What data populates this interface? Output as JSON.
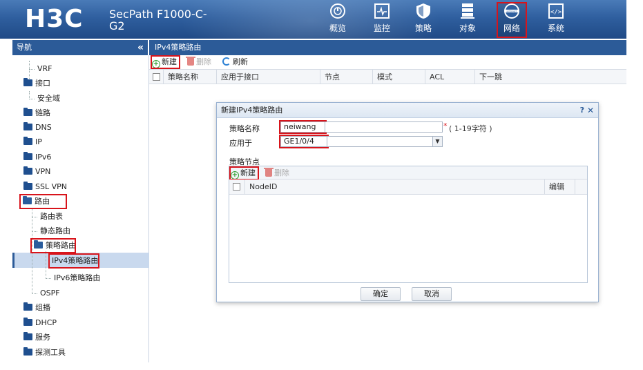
{
  "header": {
    "logo": "H3C",
    "product_line1": "SecPath F1000-C-",
    "product_line2": "G2",
    "nav": [
      {
        "label": "概览",
        "icon": "gauge-icon"
      },
      {
        "label": "监控",
        "icon": "monitor-icon"
      },
      {
        "label": "策略",
        "icon": "shield-icon"
      },
      {
        "label": "对象",
        "icon": "server-stack-icon"
      },
      {
        "label": "网络",
        "icon": "globe-internet-icon",
        "selected": true
      },
      {
        "label": "系统",
        "icon": "code-icon"
      }
    ]
  },
  "sidebar": {
    "title": "导航",
    "collapse": "«",
    "items": [
      {
        "label": "VRF"
      },
      {
        "label": "接口"
      },
      {
        "label": "安全域"
      },
      {
        "label": "链路"
      },
      {
        "label": "DNS"
      },
      {
        "label": "IP"
      },
      {
        "label": "IPv6"
      },
      {
        "label": "VPN"
      },
      {
        "label": "SSL VPN"
      },
      {
        "label": "路由"
      },
      {
        "label": "路由表"
      },
      {
        "label": "静态路由"
      },
      {
        "label": "策略路由"
      },
      {
        "label": "IPv4策略路由"
      },
      {
        "label": "IPv6策略路由"
      },
      {
        "label": "OSPF"
      },
      {
        "label": "组播"
      },
      {
        "label": "DHCP"
      },
      {
        "label": "服务"
      },
      {
        "label": "探测工具"
      }
    ]
  },
  "main": {
    "title": "IPv4策略路由",
    "toolbar": {
      "new": "新建",
      "delete": "删除",
      "refresh": "刷新"
    },
    "columns": [
      "策略名称",
      "应用于接口",
      "节点",
      "模式",
      "ACL",
      "下一跳"
    ]
  },
  "dialog": {
    "title": "新建IPv4策略路由",
    "help": "?",
    "close": "✕",
    "policy_name_label": "策略名称",
    "policy_name_value": "neiwang",
    "required": "*",
    "policy_name_hint": "( 1-19字符 )",
    "apply_label": "应用于",
    "apply_value": "GE1/0/4",
    "nodes_label": "策略节点",
    "node_toolbar": {
      "new": "新建",
      "delete": "删除"
    },
    "node_columns": [
      "NodeID",
      "编辑"
    ],
    "ok": "确定",
    "cancel": "取消"
  },
  "colors": {
    "header_bg": "#2f5f9f",
    "panel_header": "#2c5b98",
    "highlight_red": "#d8141b",
    "selection": "#c9d9ee"
  }
}
